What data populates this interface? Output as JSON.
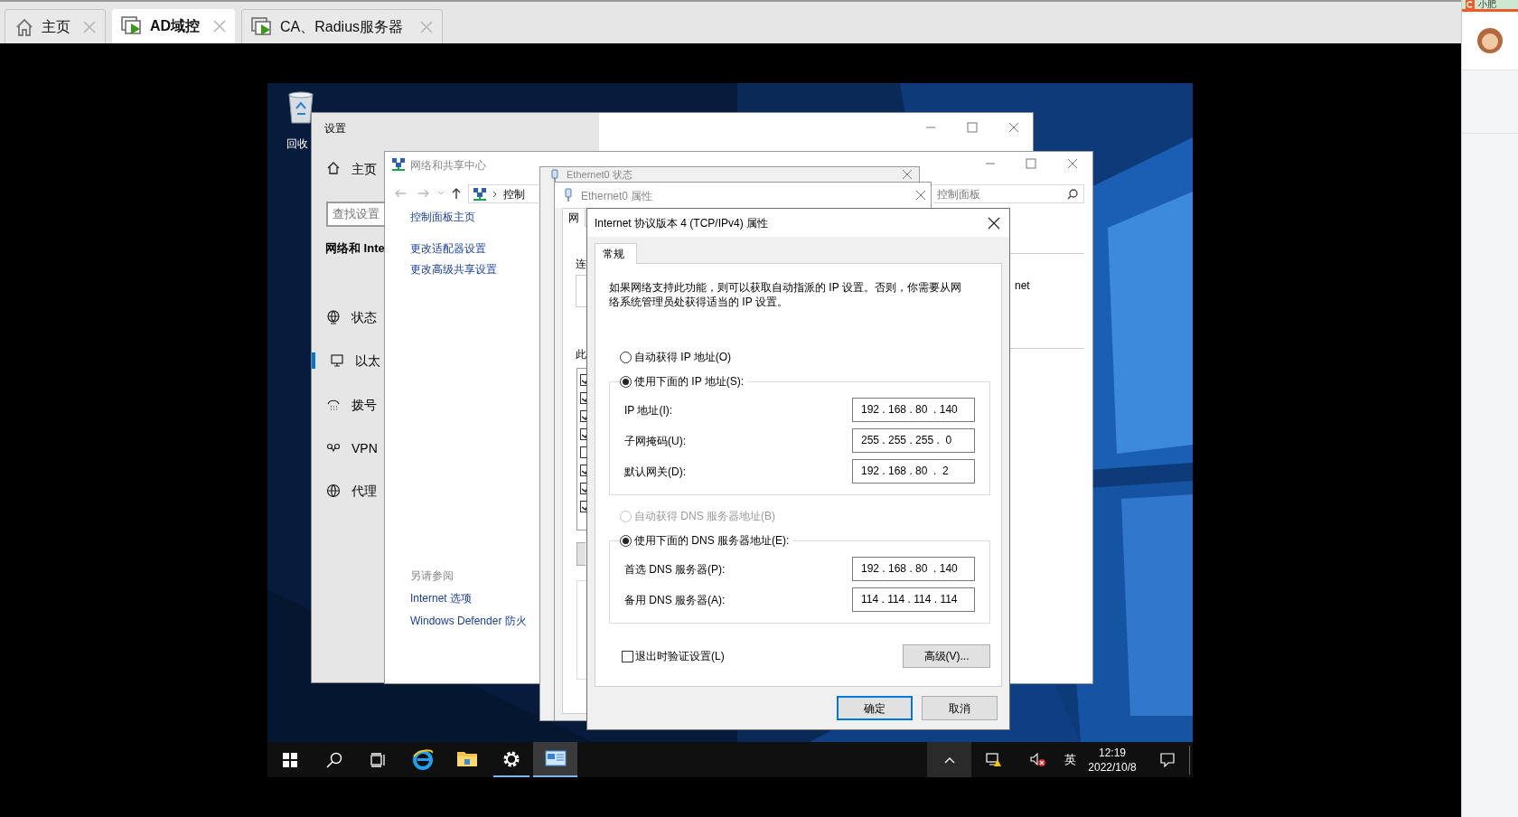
{
  "browser_tabs": [
    {
      "label": "主页",
      "selected": false,
      "kind": "home"
    },
    {
      "label": "AD域控",
      "selected": true,
      "kind": "vm"
    },
    {
      "label": "CA、Radius服务器",
      "selected": false,
      "kind": "vm"
    }
  ],
  "side_panel": {
    "text": "小肥"
  },
  "desktop": {
    "icons": [
      {
        "label": "回收"
      }
    ]
  },
  "settings_window": {
    "title": "设置",
    "home": "主页",
    "search_placeholder": "查找设置",
    "section": "网络和 Inte",
    "items": [
      {
        "label": "状态",
        "selected": false
      },
      {
        "label": "以太",
        "selected": true
      },
      {
        "label": "拨号",
        "selected": false
      },
      {
        "label": "VPN",
        "selected": false
      },
      {
        "label": "代理",
        "selected": false
      }
    ]
  },
  "network_center": {
    "title": "网络和共享中心",
    "breadcrumb": "控制",
    "search_placeholder": "控制面板",
    "links": [
      "控制面板主页",
      "更改适配器设置",
      "更改高级共享设置"
    ],
    "see_also_heading": "另请参阅",
    "see_also": [
      "Internet 选项",
      "Windows Defender 防火"
    ],
    "side_text": "net"
  },
  "status_window": {
    "title": "Ethernet0 状态"
  },
  "properties_window": {
    "title": "Ethernet0 属性",
    "tab": "网",
    "label_connect": "连",
    "label_items": "此",
    "components": [
      {
        "checked": true
      },
      {
        "checked": true
      },
      {
        "checked": true
      },
      {
        "checked": true
      },
      {
        "checked": false
      },
      {
        "checked": true
      },
      {
        "checked": true
      },
      {
        "checked": true
      }
    ]
  },
  "ipv4_dialog": {
    "title": "Internet 协议版本 4 (TCP/IPv4) 属性",
    "tabs": [
      {
        "label": "常规",
        "selected": true
      }
    ],
    "description": "如果网络支持此功能，则可以获取自动指派的 IP 设置。否则，你需要从网络系统管理员处获得适当的 IP 设置。",
    "ip_mode": [
      {
        "label": "自动获得 IP 地址(O)",
        "selected": false,
        "disabled": false
      },
      {
        "label": "使用下面的 IP 地址(S):",
        "selected": true,
        "disabled": false
      }
    ],
    "ip_fields": [
      {
        "label": "IP 地址(I):",
        "value": "192 . 168 . 80  . 140"
      },
      {
        "label": "子网掩码(U):",
        "value": "255 . 255 . 255 .  0"
      },
      {
        "label": "默认网关(D):",
        "value": "192 . 168 . 80  .  2"
      }
    ],
    "dns_mode": [
      {
        "label": "自动获得 DNS 服务器地址(B)",
        "selected": false,
        "disabled": true
      },
      {
        "label": "使用下面的 DNS 服务器地址(E):",
        "selected": true,
        "disabled": false
      }
    ],
    "dns_fields": [
      {
        "label": "首选 DNS 服务器(P):",
        "value": "192 . 168 . 80  . 140"
      },
      {
        "label": "备用 DNS 服务器(A):",
        "value": "114 . 114 . 114 . 114"
      }
    ],
    "validate_on_exit": {
      "label": "退出时验证设置(L)",
      "checked": false
    },
    "advanced_button": "高级(V)...",
    "ok_button": "确定",
    "cancel_button": "取消"
  },
  "taskbar": {
    "apps": [
      {
        "kind": "browser",
        "running": false,
        "selected": false
      },
      {
        "kind": "folder",
        "running": false,
        "selected": false
      },
      {
        "kind": "gear",
        "running": true,
        "selected": false
      },
      {
        "kind": "control-panel",
        "running": true,
        "selected": true
      }
    ],
    "input_method": "英",
    "time": "12:19",
    "date": "2022/10/8"
  }
}
